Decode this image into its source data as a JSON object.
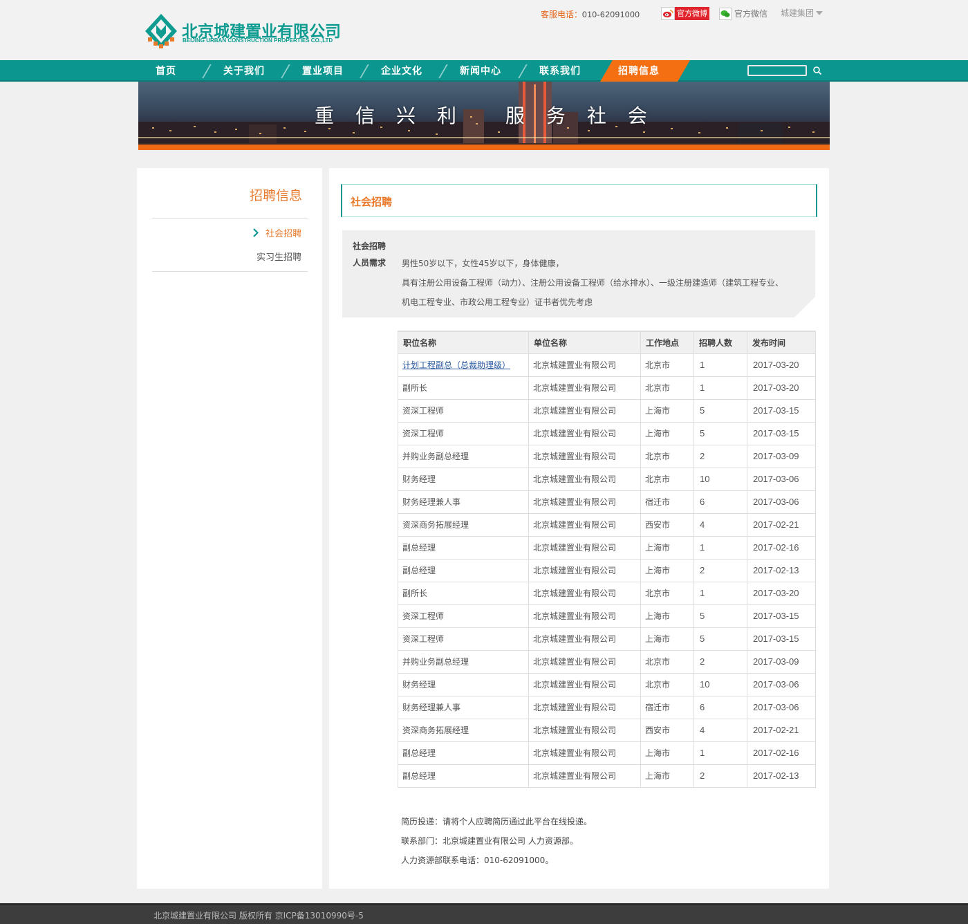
{
  "header": {
    "logo_cn": "北京城建置业有限公司",
    "logo_en": "BEIJING URBAN CONSTRUCTION PROPERTIES CO.,LTD",
    "hotline_label": "客服电话：",
    "hotline_number": "010-62091000",
    "weibo_label": "官方微博",
    "wechat_label": "官方微信",
    "group_label": "城建集团"
  },
  "nav": {
    "items": [
      "首页",
      "关于我们",
      "置业项目",
      "企业文化",
      "新闻中心",
      "联系我们",
      "招聘信息"
    ],
    "active_index": 6
  },
  "banner": {
    "slogan": "重信兴利 服务社会"
  },
  "sidebar": {
    "title": "招聘信息",
    "items": [
      "社会招聘",
      "实习生招聘"
    ],
    "active_index": 0
  },
  "main": {
    "section_title": "社会招聘",
    "requirements": {
      "heading": "社会招聘",
      "label": "人员需求",
      "lines": [
        "男性50岁以下，女性45岁以下，身体健康，",
        "具有注册公用设备工程师（动力）、注册公用设备工程师（给水排水）、一级注册建造师（建筑工程专业、",
        "机电工程专业、市政公用工程专业）证书者优先考虑"
      ]
    },
    "table": {
      "headers": [
        "职位名称",
        "单位名称",
        "工作地点",
        "招聘人数",
        "发布时间"
      ],
      "rows": [
        [
          "计划工程副总（总裁助理级）",
          "北京城建置业有限公司",
          "北京市",
          "1",
          "2017-03-20"
        ],
        [
          "副所长",
          "北京城建置业有限公司",
          "北京市",
          "1",
          "2017-03-20"
        ],
        [
          "资深工程师",
          "北京城建置业有限公司",
          "上海市",
          "5",
          "2017-03-15"
        ],
        [
          "资深工程师",
          "北京城建置业有限公司",
          "上海市",
          "5",
          "2017-03-15"
        ],
        [
          "并购业务副总经理",
          "北京城建置业有限公司",
          "北京市",
          "2",
          "2017-03-09"
        ],
        [
          "财务经理",
          "北京城建置业有限公司",
          "北京市",
          "10",
          "2017-03-06"
        ],
        [
          "财务经理兼人事",
          "北京城建置业有限公司",
          "宿迁市",
          "6",
          "2017-03-06"
        ],
        [
          "资深商务拓展经理",
          "北京城建置业有限公司",
          "西安市",
          "4",
          "2017-02-21"
        ],
        [
          "副总经理",
          "北京城建置业有限公司",
          "上海市",
          "1",
          "2017-02-16"
        ],
        [
          "副总经理",
          "北京城建置业有限公司",
          "上海市",
          "2",
          "2017-02-13"
        ],
        [
          "副所长",
          "北京城建置业有限公司",
          "北京市",
          "1",
          "2017-03-20"
        ],
        [
          "资深工程师",
          "北京城建置业有限公司",
          "上海市",
          "5",
          "2017-03-15"
        ],
        [
          "资深工程师",
          "北京城建置业有限公司",
          "上海市",
          "5",
          "2017-03-15"
        ],
        [
          "并购业务副总经理",
          "北京城建置业有限公司",
          "北京市",
          "2",
          "2017-03-09"
        ],
        [
          "财务经理",
          "北京城建置业有限公司",
          "北京市",
          "10",
          "2017-03-06"
        ],
        [
          "财务经理兼人事",
          "北京城建置业有限公司",
          "宿迁市",
          "6",
          "2017-03-06"
        ],
        [
          "资深商务拓展经理",
          "北京城建置业有限公司",
          "西安市",
          "4",
          "2017-02-21"
        ],
        [
          "副总经理",
          "北京城建置业有限公司",
          "上海市",
          "1",
          "2017-02-16"
        ],
        [
          "副总经理",
          "北京城建置业有限公司",
          "上海市",
          "2",
          "2017-02-13"
        ]
      ],
      "link_row_index": 0
    },
    "contact": [
      "简历投递：请将个人应聘简历通过此平台在线投递。",
      "联系部门：北京城建置业有限公司 人力资源部。",
      "人力资源部联系电话：010-62091000。"
    ]
  },
  "footer": {
    "text": "北京城建置业有限公司 版权所有   京ICP备13010990号-5"
  },
  "colors": {
    "brand_teal": "#0c9690",
    "accent_orange": "#f36f11",
    "title_orange": "#e8782a",
    "link_blue": "#2b5aa0"
  }
}
